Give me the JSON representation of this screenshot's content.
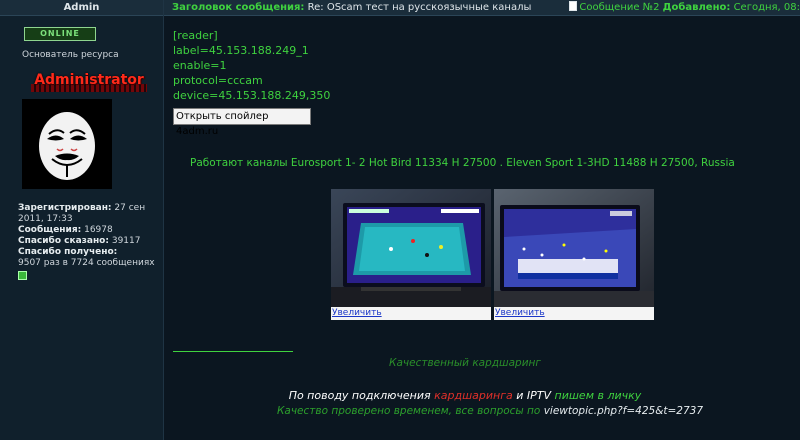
{
  "user": {
    "name": "Admin",
    "status": "Online",
    "title": "Основатель ресурса",
    "rank": "Administrator",
    "stats": [
      {
        "label": "Зарегистрирован:",
        "value": "27 сен 2011, 17:33"
      },
      {
        "label": "Сообщения:",
        "value": "16978"
      },
      {
        "label": "Спасибо сказано:",
        "value": "39117"
      },
      {
        "label": "Спасибо получено:",
        "value": "9507 раз в 7724 сообщениях"
      }
    ]
  },
  "post": {
    "subject_label": "Заголовок сообщения:",
    "subject": "Re: OScam тест на русскоязычные каналы",
    "number": "Сообщение №2",
    "added_label": "Добавлено:",
    "date": "Сегодня, 08:",
    "config_lines": [
      "[reader]",
      "label=45.153.188.249_1",
      "enable=1",
      "protocol=cccam",
      "device=45.153.188.249,350"
    ],
    "spoiler_button": "Открыть спойлер 4adm.ru",
    "channels_text": "Работают каналы Eurosport 1- 2 Hot Bird 11334 H 27500 . Eleven Sport 1-3HD 11488 H 27500, Russia",
    "images": [
      {
        "link": "Увеличить"
      },
      {
        "link": "Увеличить"
      }
    ]
  },
  "signature": {
    "line1": "Качественный кардшаринг",
    "line2_a": "По поводу подключения ",
    "line2_b": "кардшаринга",
    "line2_c": " и IPTV ",
    "line2_d": "пишем в личку",
    "line3_a": "Качество проверено временем, все вопросы по ",
    "line3_link": "viewtopic.php?f=425&t=2737"
  },
  "colors": {
    "background": "#0b1620",
    "accent_green": "#3fd23f",
    "rank_red": "#ff2a1a",
    "link_blue": "#1b37c8"
  }
}
